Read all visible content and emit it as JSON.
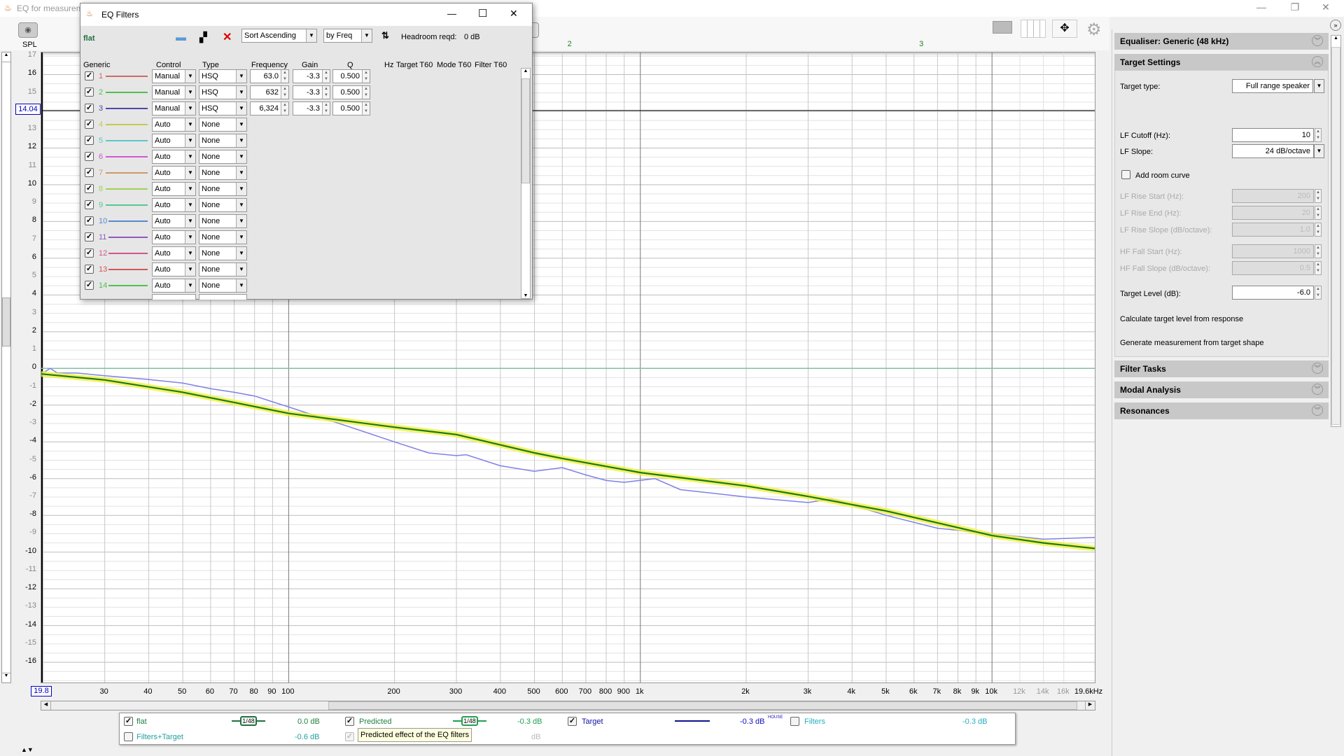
{
  "window": {
    "title": "EQ for measurem",
    "minimize": "—",
    "restore": "❐",
    "close": "✕"
  },
  "main": {
    "spl_label": "SPL",
    "cursor_y": "14.04",
    "cursor_x": "19.8",
    "behind_button": "s",
    "filter_markers": [
      {
        "label": "2",
        "freq": 632
      },
      {
        "label": "3",
        "freq": 6324
      }
    ]
  },
  "dialog": {
    "title": "EQ Filters",
    "minimize": "—",
    "maximize": "☐",
    "close": "✕",
    "measurement": "flat",
    "sort_order": "Sort Ascending",
    "sort_by": "by Freq",
    "headroom_label": "Headroom reqd:",
    "headroom_value": "0 dB",
    "headers": {
      "generic": "Generic",
      "control": "Control",
      "type": "Type",
      "frequency": "Frequency",
      "gain": "Gain",
      "q": "Q",
      "hz": "Hz",
      "target_t60": "Target T60",
      "mode_t60": "Mode T60",
      "filter_t60": "Filter T60"
    },
    "filters": [
      {
        "n": "1",
        "color": "#d06868",
        "control": "Manual",
        "type": "HSQ",
        "freq": "63.0",
        "gain": "-3.3",
        "q": "0.500",
        "checked": true
      },
      {
        "n": "2",
        "color": "#50c050",
        "control": "Manual",
        "type": "HSQ",
        "freq": "632",
        "gain": "-3.3",
        "q": "0.500",
        "checked": true
      },
      {
        "n": "3",
        "color": "#4848b0",
        "control": "Manual",
        "type": "HSQ",
        "freq": "6,324",
        "gain": "-3.3",
        "q": "0.500",
        "checked": true
      },
      {
        "n": "4",
        "color": "#c8c850",
        "control": "Auto",
        "type": "None",
        "checked": true
      },
      {
        "n": "5",
        "color": "#58c8c8",
        "control": "Auto",
        "type": "None",
        "checked": true
      },
      {
        "n": "6",
        "color": "#d058d0",
        "control": "Auto",
        "type": "None",
        "checked": true
      },
      {
        "n": "7",
        "color": "#d09868",
        "control": "Auto",
        "type": "None",
        "checked": true
      },
      {
        "n": "8",
        "color": "#a0d058",
        "control": "Auto",
        "type": "None",
        "checked": true
      },
      {
        "n": "9",
        "color": "#58c890",
        "control": "Auto",
        "type": "None",
        "checked": true
      },
      {
        "n": "10",
        "color": "#5888d0",
        "control": "Auto",
        "type": "None",
        "checked": true
      },
      {
        "n": "11",
        "color": "#9058c0",
        "control": "Auto",
        "type": "None",
        "checked": true
      },
      {
        "n": "12",
        "color": "#d05888",
        "control": "Auto",
        "type": "None",
        "checked": true
      },
      {
        "n": "13",
        "color": "#d05858",
        "control": "Auto",
        "type": "None",
        "checked": true
      },
      {
        "n": "14",
        "color": "#50c050",
        "control": "Auto",
        "type": "None",
        "checked": true
      }
    ]
  },
  "panel": {
    "equaliser": "Equaliser: Generic (48 kHz)",
    "target_settings": "Target Settings",
    "target_type_label": "Target type:",
    "target_type": "Full range speaker",
    "lf_cutoff_label": "LF Cutoff (Hz):",
    "lf_cutoff": "10",
    "lf_slope_label": "LF Slope:",
    "lf_slope": "24 dB/octave",
    "add_room_curve": "Add room curve",
    "lf_rise_start_label": "LF Rise Start (Hz):",
    "lf_rise_start": "200",
    "lf_rise_end_label": "LF Rise End (Hz):",
    "lf_rise_end": "20",
    "lf_rise_slope_label": "LF Rise Slope (dB/octave):",
    "lf_rise_slope": "1.0",
    "hf_fall_start_label": "HF Fall Start (Hz):",
    "hf_fall_start": "1000",
    "hf_fall_slope_label": "HF Fall Slope (dB/octave):",
    "hf_fall_slope": "0.5",
    "target_level_label": "Target Level (dB):",
    "target_level": "-6.0",
    "calc_target": "Calculate target level from response",
    "generate_measurement": "Generate measurement from target shape",
    "filter_tasks": "Filter Tasks",
    "modal_analysis": "Modal Analysis",
    "resonances": "Resonances"
  },
  "legend": {
    "flat": {
      "label": "flat",
      "smoothing": "1/48",
      "value": "0.0 dB",
      "checked": true
    },
    "predicted": {
      "label": "Predicted",
      "smoothing": "1/48",
      "value": "-0.3 dB",
      "checked": true
    },
    "target": {
      "label": "Target",
      "value": "-0.3 dB",
      "sup": "HOUSE",
      "checked": true
    },
    "filters": {
      "label": "Filters",
      "value": "-0.3 dB",
      "checked": false
    },
    "filters_target": {
      "label": "Filters+Target",
      "value": "-0.6 dB",
      "checked": false
    },
    "extra_value": "dB",
    "tooltip": "Predicted effect of the EQ filters"
  },
  "chart_data": {
    "type": "line",
    "xscale": "log",
    "xlim": [
      19.8,
      19600
    ],
    "ylim": [
      -17.1,
      17.2
    ],
    "ylabel": "SPL",
    "grid": true,
    "x_ticks": [
      "30",
      "40",
      "50",
      "60",
      "70",
      "80",
      "90",
      "100",
      "200",
      "300",
      "400",
      "500",
      "600",
      "700",
      "800",
      "900",
      "1k",
      "2k",
      "3k",
      "4k",
      "5k",
      "6k",
      "7k",
      "8k",
      "9k",
      "10k",
      "12k",
      "14k",
      "16k",
      "19.6kHz"
    ],
    "x_tick_values": [
      30,
      40,
      50,
      60,
      70,
      80,
      90,
      100,
      200,
      300,
      400,
      500,
      600,
      700,
      800,
      900,
      1000,
      2000,
      3000,
      4000,
      5000,
      6000,
      7000,
      8000,
      9000,
      10000,
      12000,
      14000,
      16000,
      19600
    ],
    "y_ticks": [
      17,
      16,
      15,
      13,
      12,
      11,
      10,
      9,
      8,
      7,
      6,
      5,
      4,
      3,
      2,
      1,
      0,
      -1,
      -2,
      -3,
      -4,
      -5,
      -6,
      -7,
      -8,
      -9,
      -10,
      -11,
      -12,
      -13,
      -14,
      -15,
      -16
    ],
    "series": [
      {
        "name": "flat",
        "color": "#8080e8",
        "x": [
          19.8,
          21,
          22,
          25,
          30,
          40,
          50,
          60,
          70,
          80,
          100,
          120,
          150,
          200,
          250,
          300,
          320,
          400,
          500,
          600,
          700,
          800,
          900,
          1100,
          1300,
          2000,
          3000,
          3500,
          5000,
          7000,
          10000,
          14000,
          19600
        ],
        "y": [
          -0.3,
          0.0,
          -0.25,
          -0.25,
          -0.4,
          -0.6,
          -0.8,
          -1.1,
          -1.3,
          -1.5,
          -2.1,
          -2.6,
          -3.2,
          -4.0,
          -4.6,
          -4.75,
          -4.7,
          -5.3,
          -5.6,
          -5.4,
          -5.8,
          -6.1,
          -6.2,
          -6.0,
          -6.6,
          -7.0,
          -7.3,
          -7.1,
          -8.0,
          -8.7,
          -9.0,
          -9.3,
          -9.2
        ]
      },
      {
        "name": "Predicted",
        "color": "#1a7a1a",
        "x": [
          19.8,
          30,
          50,
          70,
          100,
          200,
          300,
          500,
          600,
          1000,
          2000,
          3000,
          5000,
          10000,
          14000,
          19600
        ],
        "y": [
          -0.3,
          -0.63,
          -1.3,
          -1.85,
          -2.45,
          -3.2,
          -3.6,
          -4.6,
          -4.9,
          -5.67,
          -6.4,
          -6.97,
          -7.76,
          -9.1,
          -9.5,
          -9.8
        ]
      },
      {
        "name": "Filters",
        "color": "#80c0a0",
        "x": [
          19.8,
          19600
        ],
        "y": [
          0,
          0
        ]
      }
    ]
  }
}
